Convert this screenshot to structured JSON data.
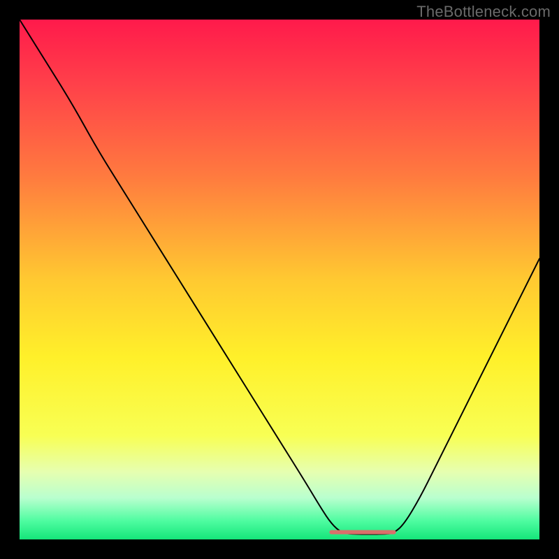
{
  "watermark": "TheBottleneck.com",
  "chart_data": {
    "type": "line",
    "title": "",
    "xlabel": "",
    "ylabel": "",
    "xlim": [
      0,
      100
    ],
    "ylim": [
      0,
      100
    ],
    "background_gradient": {
      "stops": [
        {
          "offset": 0.0,
          "color": "#ff1a4b"
        },
        {
          "offset": 0.12,
          "color": "#ff3f4a"
        },
        {
          "offset": 0.3,
          "color": "#ff7a3f"
        },
        {
          "offset": 0.5,
          "color": "#ffc931"
        },
        {
          "offset": 0.65,
          "color": "#fff02a"
        },
        {
          "offset": 0.8,
          "color": "#f8ff54"
        },
        {
          "offset": 0.87,
          "color": "#e6ffb0"
        },
        {
          "offset": 0.92,
          "color": "#b9ffcf"
        },
        {
          "offset": 0.965,
          "color": "#4dfca0"
        },
        {
          "offset": 1.0,
          "color": "#15e57a"
        }
      ]
    },
    "curve": {
      "comment": "y = bottleneck percent (0 at valley floor, 100 at top). x spans full chart width.",
      "points": [
        {
          "x": 0,
          "y": 100
        },
        {
          "x": 5,
          "y": 92
        },
        {
          "x": 10,
          "y": 84
        },
        {
          "x": 15,
          "y": 75
        },
        {
          "x": 20,
          "y": 67
        },
        {
          "x": 25,
          "y": 59
        },
        {
          "x": 30,
          "y": 51
        },
        {
          "x": 35,
          "y": 43
        },
        {
          "x": 40,
          "y": 35
        },
        {
          "x": 45,
          "y": 27
        },
        {
          "x": 50,
          "y": 19
        },
        {
          "x": 55,
          "y": 11
        },
        {
          "x": 58,
          "y": 6
        },
        {
          "x": 60,
          "y": 3
        },
        {
          "x": 62,
          "y": 1.2
        },
        {
          "x": 65,
          "y": 1.0
        },
        {
          "x": 70,
          "y": 1.0
        },
        {
          "x": 72,
          "y": 1.2
        },
        {
          "x": 74,
          "y": 3
        },
        {
          "x": 77,
          "y": 8
        },
        {
          "x": 80,
          "y": 14
        },
        {
          "x": 85,
          "y": 24
        },
        {
          "x": 90,
          "y": 34
        },
        {
          "x": 95,
          "y": 44
        },
        {
          "x": 100,
          "y": 54
        }
      ]
    },
    "optimal_band": {
      "comment": "Flat red highlighted segment at valley floor indicating optimal range.",
      "x_start": 60,
      "x_end": 72,
      "y": 1.4,
      "color": "#d9706b",
      "stroke_width": 6
    },
    "curve_style": {
      "color": "#000000",
      "stroke_width": 2
    }
  }
}
